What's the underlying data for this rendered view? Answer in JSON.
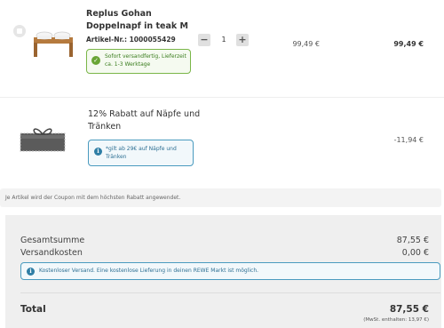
{
  "cart": {
    "item": {
      "title": "Replus Gohan Doppelnapf in teak M",
      "article_number": "Artikel-Nr.: 1000055429",
      "stock_status": "Sofort versandfertig, Lieferzeit ca. 1-3 Werktage",
      "quantity": "1",
      "minus": "−",
      "plus": "+",
      "unit_price": "99,49 €",
      "line_total": "99,49 €"
    },
    "coupon": {
      "title": "12% Rabatt auf Näpfe und Tränken",
      "note": "*gilt ab 29€ auf Näpfe und Tränken",
      "amount": "-11,94 €"
    },
    "notice": "Je Artikel wird der Coupon mit dem höchsten Rabatt angewendet."
  },
  "summary": {
    "subtotal_label": "Gesamtsumme",
    "subtotal_value": "87,55 €",
    "shipping_label": "Versandkosten",
    "shipping_value": "0,00 €",
    "shipping_info": "Kostenloser Versand. Eine kostenlose Lieferung in deinen REWE Markt ist möglich.",
    "total_label": "Total",
    "total_value": "87,55 €",
    "vat_note": "(MwSt. enthalten: 13,97 €)"
  },
  "icons": {
    "info": "i",
    "check": "✓"
  },
  "colors": {
    "success_border": "#7ab648",
    "info_border": "#4a9bbf",
    "summary_bg": "#efefef"
  }
}
